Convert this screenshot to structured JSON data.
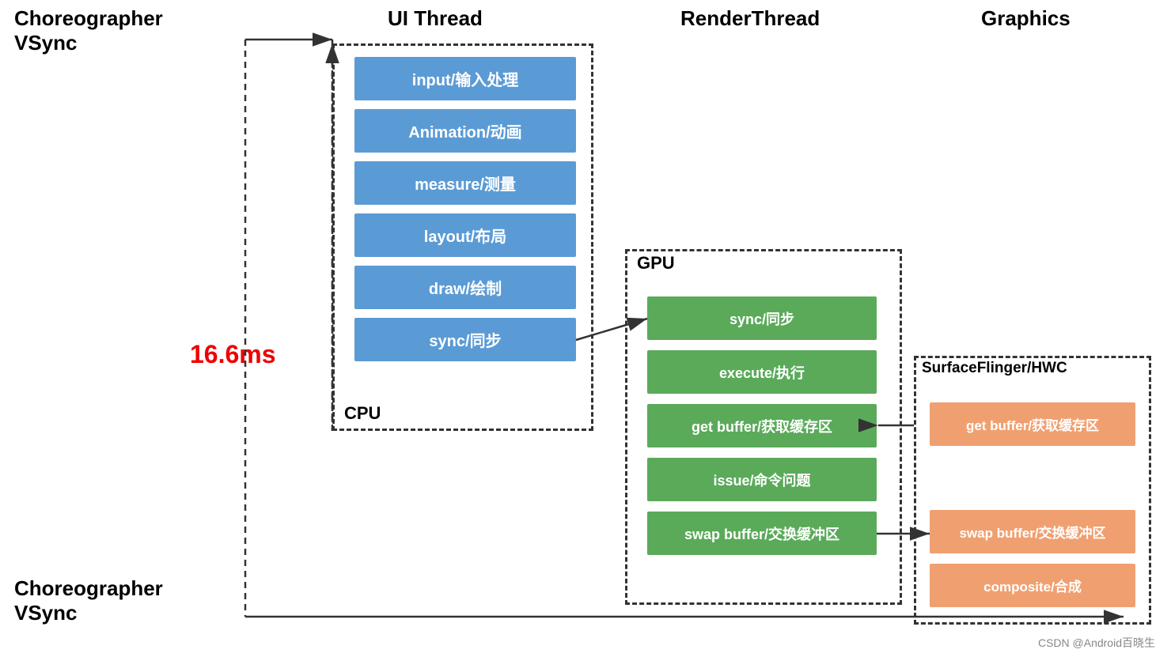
{
  "headers": {
    "choreographer_vsync": "Choreographer\nVSync",
    "ui_thread": "UI Thread",
    "render_thread": "RenderThread",
    "graphics": "Graphics"
  },
  "labels": {
    "cpu": "CPU",
    "gpu": "GPU",
    "surface_flinger": "SurfaceFlinger/HWC",
    "timing": "16.6ms",
    "watermark": "CSDN @Android百晓生"
  },
  "ui_blocks": [
    "input/输入处理",
    "Animation/动画",
    "measure/测量",
    "layout/布局",
    "draw/绘制",
    "sync/同步"
  ],
  "gpu_blocks": [
    "sync/同步",
    "execute/执行",
    "get buffer/获取缓存区",
    "issue/命令问题",
    "swap buffer/交换缓冲区"
  ],
  "sf_blocks": [
    "get buffer/获取缓存区",
    "swap buffer/交换缓冲区",
    "composite/合成"
  ]
}
